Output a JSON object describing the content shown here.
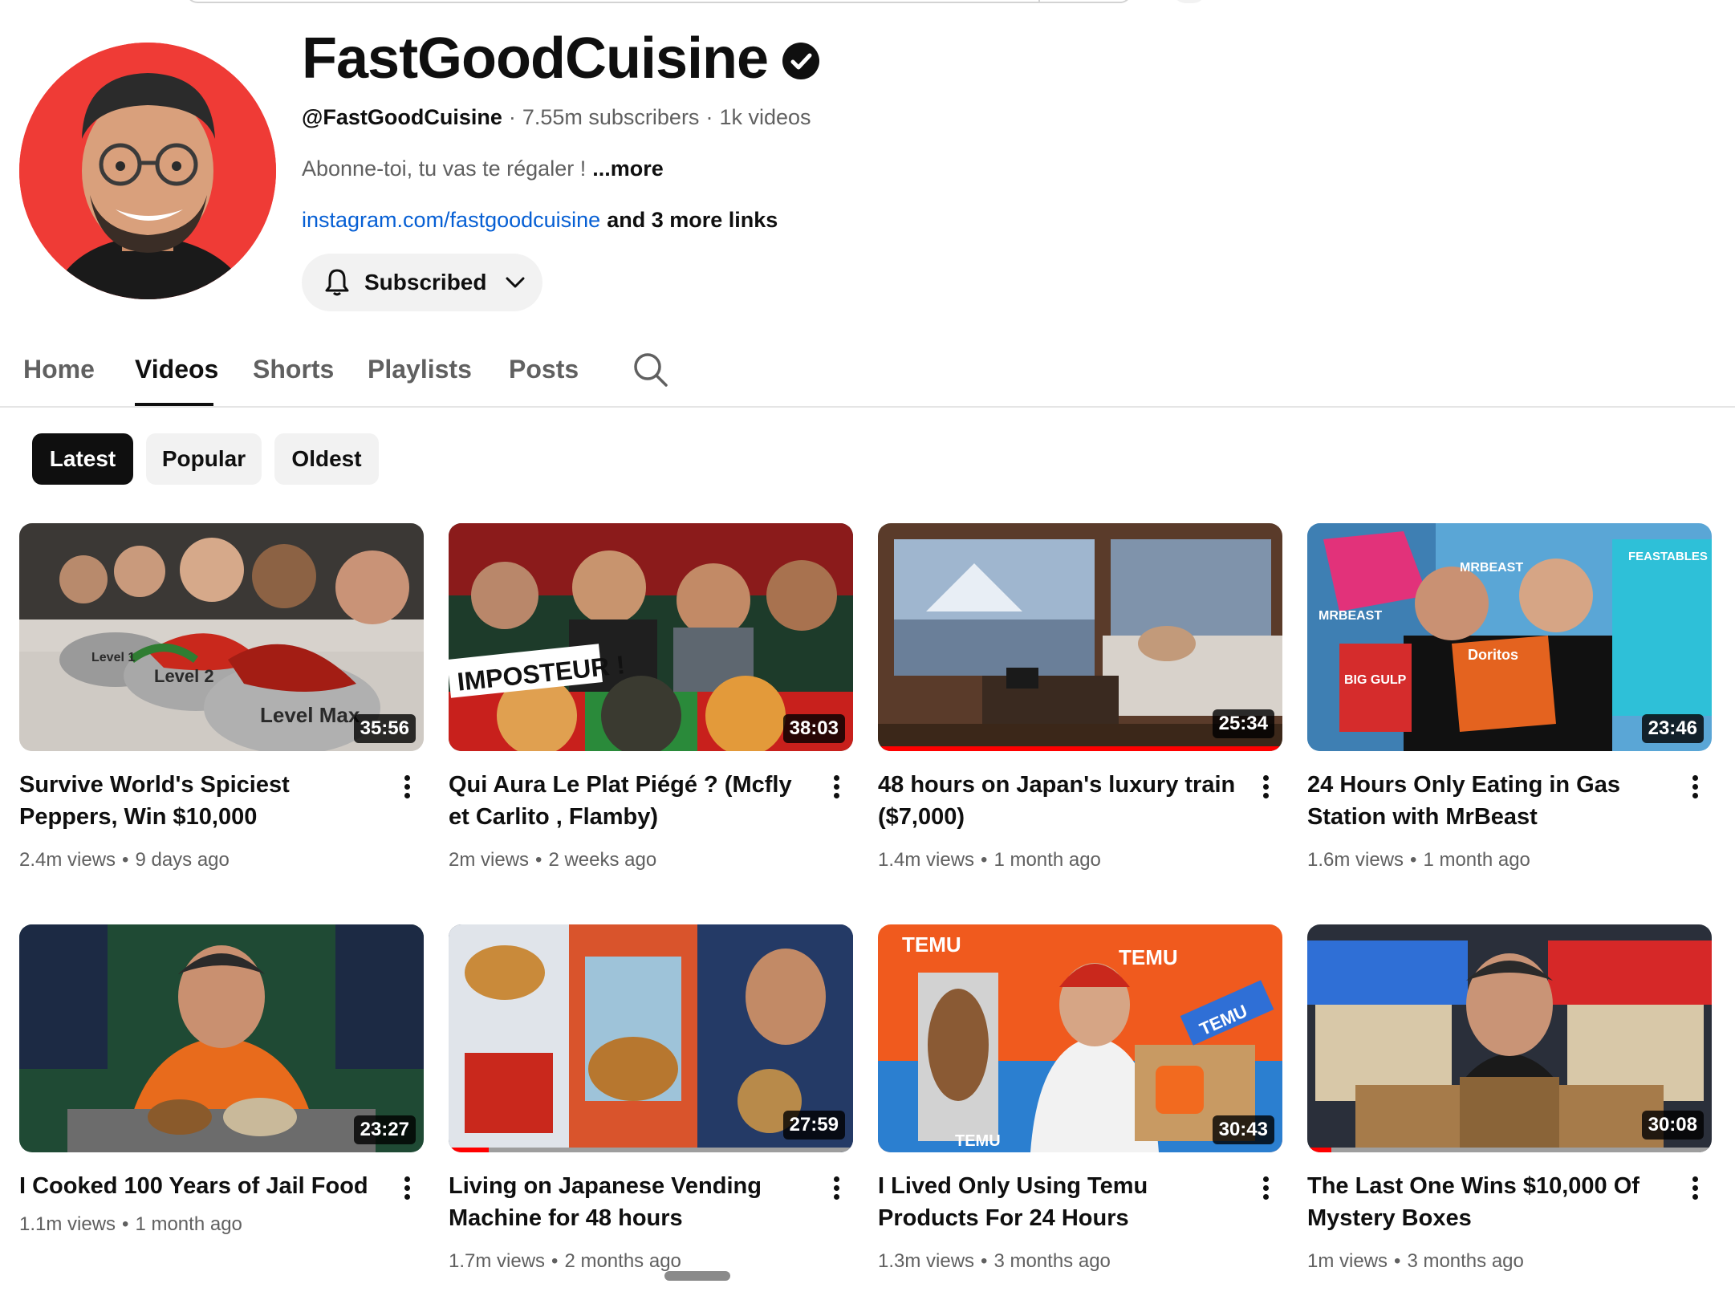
{
  "channel": {
    "name": "FastGoodCuisine",
    "handle": "@FastGoodCuisine",
    "subscribers": "7.55m subscribers",
    "video_count": "1k videos",
    "description": "Abonne-toi, tu vas te régaler !",
    "description_more": "...more",
    "link": "instagram.com/fastgoodcuisine",
    "more_links": "and 3 more links",
    "subscribe_label": "Subscribed"
  },
  "tabs": [
    {
      "label": "Home",
      "active": false
    },
    {
      "label": "Videos",
      "active": true
    },
    {
      "label": "Shorts",
      "active": false
    },
    {
      "label": "Playlists",
      "active": false
    },
    {
      "label": "Posts",
      "active": false
    }
  ],
  "chips": [
    {
      "label": "Latest",
      "active": true
    },
    {
      "label": "Popular",
      "active": false
    },
    {
      "label": "Oldest",
      "active": false
    }
  ],
  "videos": [
    {
      "title": "Survive World's Spiciest Peppers, Win $10,000",
      "views": "2.4m views",
      "age": "9 days ago",
      "duration": "35:56",
      "watched": 0
    },
    {
      "title": "Qui Aura Le Plat Piégé ? (Mcfly et Carlito , Flamby)",
      "views": "2m views",
      "age": "2 weeks ago",
      "duration": "38:03",
      "watched": 0
    },
    {
      "title": "48 hours on Japan's luxury train ($7,000)",
      "views": "1.4m views",
      "age": "1 month ago",
      "duration": "25:34",
      "watched": 1.0
    },
    {
      "title": "24 Hours Only Eating in Gas Station with MrBeast",
      "views": "1.6m views",
      "age": "1 month ago",
      "duration": "23:46",
      "watched": 0
    },
    {
      "title": "I  Cooked 100 Years of Jail Food",
      "views": "1.1m views",
      "age": "1 month ago",
      "duration": "23:27",
      "watched": 0
    },
    {
      "title": "Living on Japanese Vending Machine for 48 hours",
      "views": "1.7m views",
      "age": "2 months ago",
      "duration": "27:59",
      "watched": 0.1
    },
    {
      "title": "I Lived Only Using Temu Products For 24 Hours",
      "views": "1.3m views",
      "age": "3 months ago",
      "duration": "30:43",
      "watched": 0
    },
    {
      "title": "The Last One Wins $10,000 Of Mystery Boxes",
      "views": "1m views",
      "age": "3 months ago",
      "duration": "30:08",
      "watched": 0.06
    }
  ],
  "thumb_text": {
    "v0": [
      "Level 1",
      "Level 2",
      "Level Max"
    ],
    "v1": [
      "IMPOSTEUR !"
    ],
    "v3": [
      "MRBEAST",
      "MRBEAST",
      "FEASTABLES",
      "BIG GULP",
      "Doritos"
    ],
    "v6": [
      "TEMU",
      "TEMU",
      "TEMU",
      "TEMU"
    ]
  },
  "colors": {
    "accent_link": "#065fd4",
    "chip_active_bg": "#0f0f0f",
    "progress_red": "#ff0000",
    "avatar_bg": "#ef3b36"
  },
  "icons": [
    "verified-badge-icon",
    "bell-icon",
    "chevron-down-icon",
    "search-icon",
    "more-vert-icon"
  ]
}
